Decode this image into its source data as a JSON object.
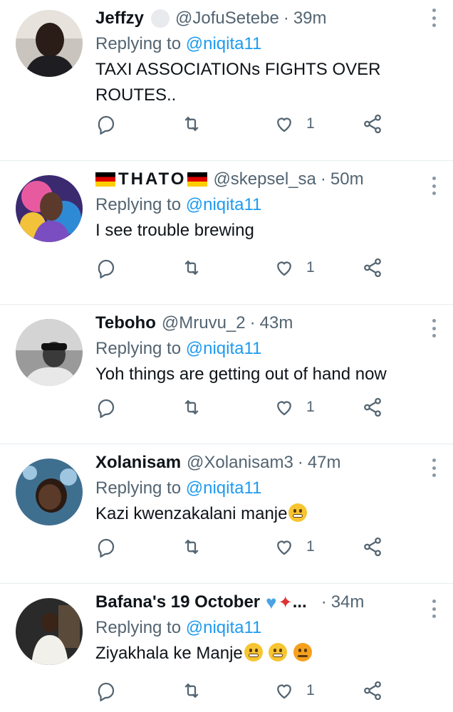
{
  "replies": [
    {
      "display_name": "Jeffzy",
      "handle": "@JofuSetebe",
      "time": "39m",
      "replying_prefix": "Replying to",
      "replying_to": "@niqita11",
      "text": "TAXI ASSOCIATIONs FIGHTS OVER ROUTES..",
      "likes": "1"
    },
    {
      "display_name": "THATO",
      "handle": "@skepsel_sa",
      "time": "50m",
      "replying_prefix": "Replying to",
      "replying_to": "@niqita11",
      "text": "I see trouble brewing",
      "likes": "1"
    },
    {
      "display_name": "Teboho",
      "handle": "@Mruvu_2",
      "time": "43m",
      "replying_prefix": "Replying to",
      "replying_to": "@niqita11",
      "text": "Yoh things are getting out of hand now",
      "likes": "1"
    },
    {
      "display_name": "Xolanisam",
      "handle": "@Xolanisam3",
      "time": "47m",
      "replying_prefix": "Replying to",
      "replying_to": "@niqita11",
      "text": "Kazi kwenzakalani manje",
      "likes": "1"
    },
    {
      "display_name": "Bafana's 19 October",
      "name_suffix": "...",
      "handle": "",
      "time": "34m",
      "replying_prefix": "Replying to",
      "replying_to": "@niqita11",
      "text": "Ziyakhala ke Manje",
      "likes": "1"
    }
  ],
  "colors": {
    "accent": "#1d9bf0",
    "secondary_text": "#536471",
    "divider": "#e6ecf0"
  },
  "icons": [
    "reply-icon",
    "retweet-icon",
    "like-icon",
    "share-icon",
    "more-icon"
  ]
}
